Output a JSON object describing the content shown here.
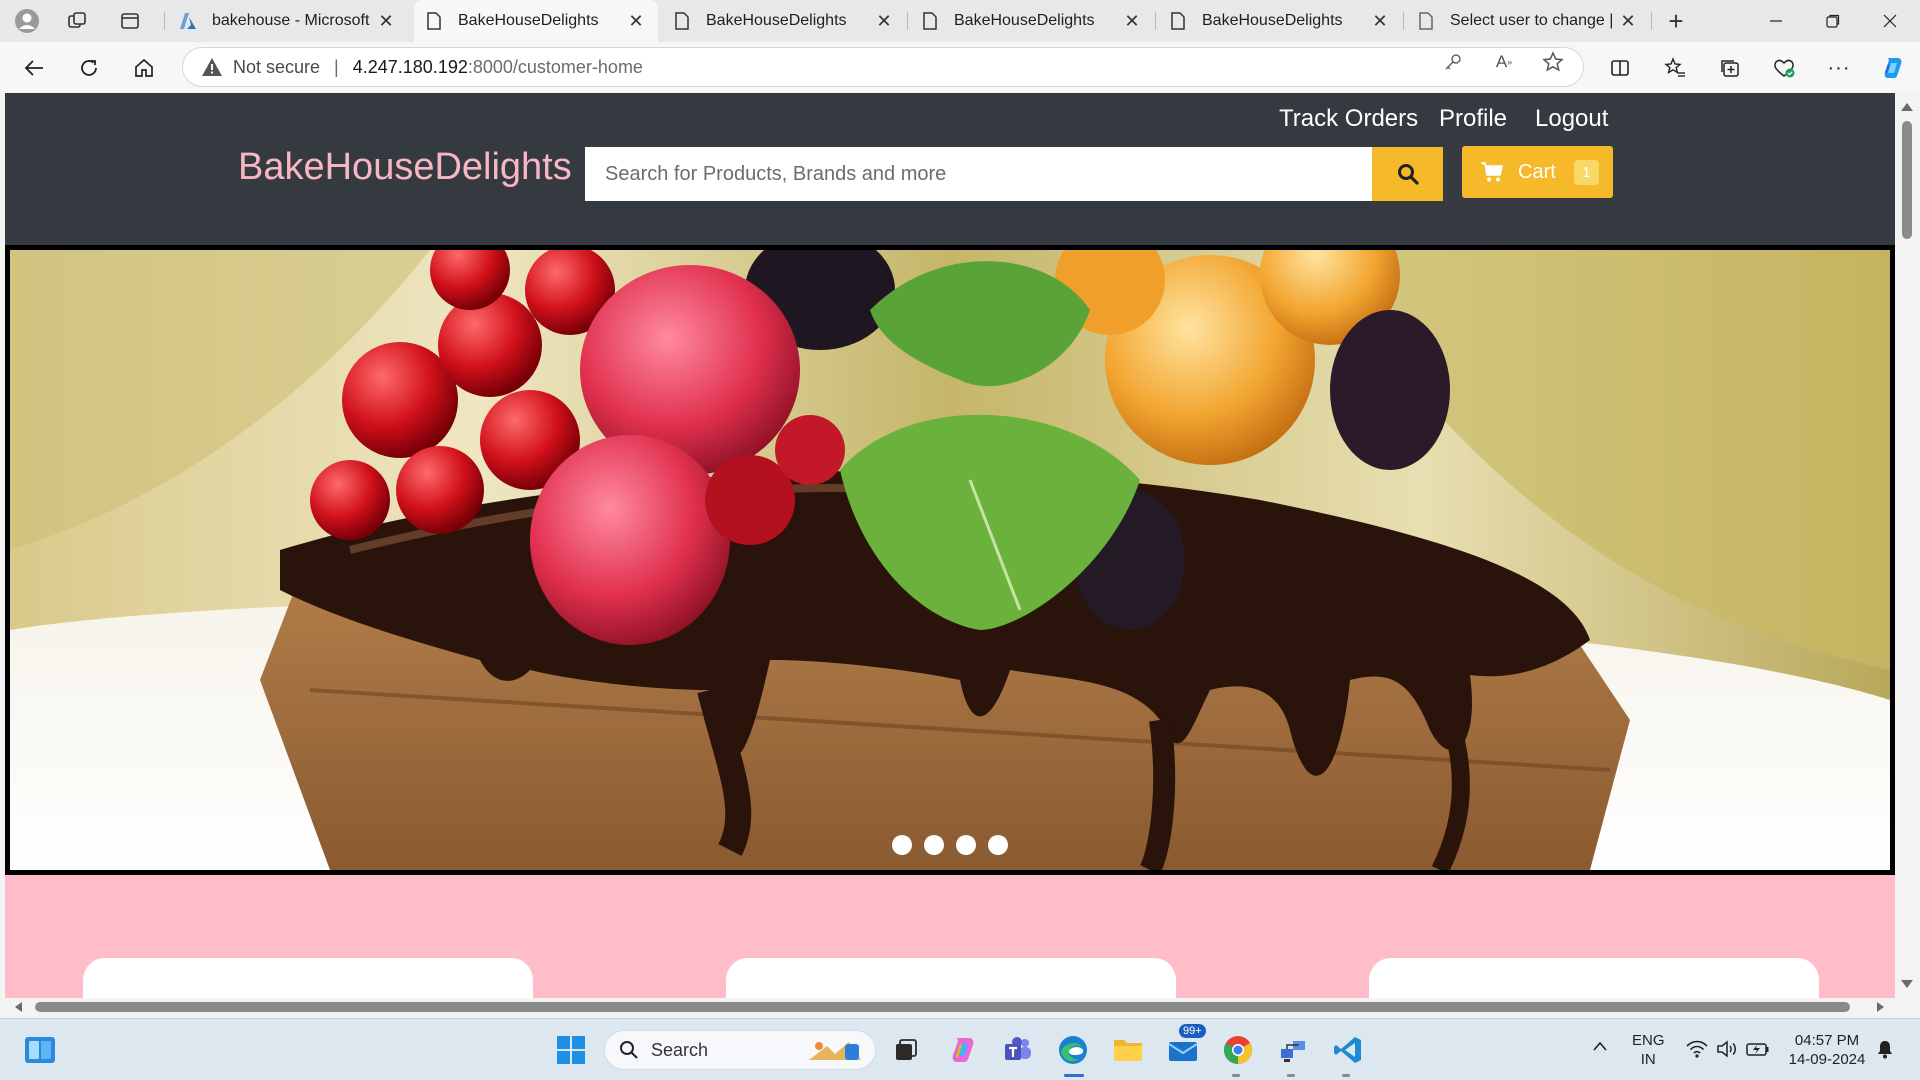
{
  "browser": {
    "tabs": [
      {
        "title": "bakehouse - Microsoft Az",
        "icon": "azure-icon",
        "active": false
      },
      {
        "title": "BakeHouseDelights",
        "icon": "page-icon",
        "active": true
      },
      {
        "title": "BakeHouseDelights",
        "icon": "page-icon",
        "active": false
      },
      {
        "title": "BakeHouseDelights",
        "icon": "page-icon",
        "active": false
      },
      {
        "title": "BakeHouseDelights",
        "icon": "page-icon",
        "active": false
      },
      {
        "title": "Select user to change | Dj",
        "icon": "page-icon",
        "active": false
      }
    ],
    "address": {
      "security_label": "Not secure",
      "url_host": "4.247.180.192",
      "url_path": ":8000/customer-home"
    }
  },
  "site": {
    "brand": "BakeHouseDelights",
    "nav": {
      "track_orders": "Track Orders",
      "profile": "Profile",
      "logout": "Logout"
    },
    "search": {
      "placeholder": "Search for Products, Brands and more"
    },
    "cart": {
      "label": "Cart",
      "count": "1"
    },
    "carousel": {
      "slide_count": 4,
      "active_index": 0
    },
    "colors": {
      "header_bg": "#343a40",
      "brand": "#f8b6c3",
      "accent": "#f5b92a",
      "content_bg": "#ffbdc9"
    }
  },
  "taskbar": {
    "search_label": "Search",
    "mail_badge": "99+",
    "language": "ENG",
    "region": "IN",
    "time": "04:57 PM",
    "date": "14-09-2024"
  }
}
